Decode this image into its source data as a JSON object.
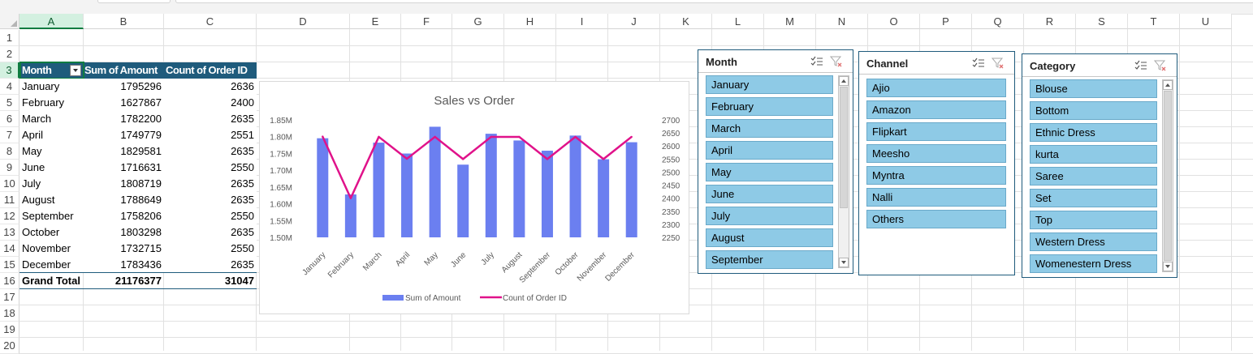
{
  "columns": [
    "A",
    "B",
    "C",
    "D",
    "E",
    "F",
    "G",
    "H",
    "I",
    "J",
    "K",
    "L",
    "M",
    "N",
    "O",
    "P",
    "Q",
    "R",
    "S",
    "T",
    "U"
  ],
  "rows": [
    "1",
    "2",
    "3",
    "4",
    "5",
    "6",
    "7",
    "8",
    "9",
    "10",
    "11",
    "12",
    "13",
    "14",
    "15",
    "16",
    "17",
    "18",
    "19",
    "20"
  ],
  "pivot": {
    "headers": [
      "Month",
      "Sum of Amount",
      "Count of Order ID"
    ],
    "rows": [
      {
        "month": "January",
        "amount": "1795296",
        "count": "2636"
      },
      {
        "month": "February",
        "amount": "1627867",
        "count": "2400"
      },
      {
        "month": "March",
        "amount": "1782200",
        "count": "2635"
      },
      {
        "month": "April",
        "amount": "1749779",
        "count": "2551"
      },
      {
        "month": "May",
        "amount": "1829581",
        "count": "2635"
      },
      {
        "month": "June",
        "amount": "1716631",
        "count": "2550"
      },
      {
        "month": "July",
        "amount": "1808719",
        "count": "2635"
      },
      {
        "month": "August",
        "amount": "1788649",
        "count": "2635"
      },
      {
        "month": "September",
        "amount": "1758206",
        "count": "2550"
      },
      {
        "month": "October",
        "amount": "1803298",
        "count": "2635"
      },
      {
        "month": "November",
        "amount": "1732715",
        "count": "2550"
      },
      {
        "month": "December",
        "amount": "1783436",
        "count": "2635"
      }
    ],
    "grand": {
      "label": "Grand Total",
      "amount": "21176377",
      "count": "31047"
    }
  },
  "chart_data": {
    "type": "bar",
    "title": "Sales vs Order",
    "categories": [
      "January",
      "February",
      "March",
      "April",
      "May",
      "June",
      "July",
      "August",
      "September",
      "October",
      "November",
      "December"
    ],
    "series": [
      {
        "name": "Sum of Amount",
        "type": "bar",
        "axis": "left",
        "color": "#6b7ff0",
        "values": [
          1795296,
          1627867,
          1782200,
          1749779,
          1829581,
          1716631,
          1808719,
          1788649,
          1758206,
          1803298,
          1732715,
          1783436
        ]
      },
      {
        "name": "Count of Order ID",
        "type": "line",
        "axis": "right",
        "color": "#e0128a",
        "values": [
          2636,
          2400,
          2635,
          2551,
          2635,
          2550,
          2635,
          2635,
          2550,
          2635,
          2550,
          2635
        ]
      }
    ],
    "left_axis": {
      "min": 1500000,
      "max": 1850000,
      "ticks": [
        "1.50M",
        "1.55M",
        "1.60M",
        "1.65M",
        "1.70M",
        "1.75M",
        "1.80M",
        "1.85M"
      ]
    },
    "right_axis": {
      "min": 2250,
      "max": 2700,
      "ticks": [
        "2250",
        "2300",
        "2350",
        "2400",
        "2450",
        "2500",
        "2550",
        "2600",
        "2650",
        "2700"
      ]
    },
    "legend_position": "bottom"
  },
  "slicers": {
    "month": {
      "title": "Month",
      "items": [
        "January",
        "February",
        "March",
        "April",
        "May",
        "June",
        "July",
        "August",
        "September"
      ]
    },
    "channel": {
      "title": "Channel",
      "items": [
        "Ajio",
        "Amazon",
        "Flipkart",
        "Meesho",
        "Myntra",
        "Nalli",
        "Others"
      ]
    },
    "category": {
      "title": "Category",
      "items": [
        "Blouse",
        "Bottom",
        "Ethnic Dress",
        "kurta",
        "Saree",
        "Set",
        "Top",
        "Western Dress",
        "Womenestern Dress"
      ]
    }
  }
}
